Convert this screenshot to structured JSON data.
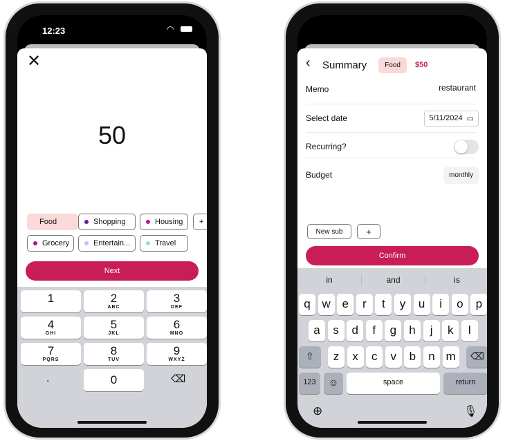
{
  "left": {
    "status": {
      "time": "12:23"
    },
    "amount": "50",
    "categories": [
      {
        "label": "Food",
        "color": "#f8d3d3",
        "selected": true
      },
      {
        "label": "Shopping",
        "color": "#6a1aa8"
      },
      {
        "label": "Housing",
        "color": "#c21896"
      },
      {
        "label": "+"
      },
      {
        "label": "Grocery",
        "color": "#a0199a"
      },
      {
        "label": "Entertain...",
        "color": "#d8b4f8"
      },
      {
        "label": "Travel",
        "color": "#8ee8c8"
      }
    ],
    "next_label": "Next",
    "keys": [
      {
        "d": "1",
        "l": ""
      },
      {
        "d": "2",
        "l": "ABC"
      },
      {
        "d": "3",
        "l": "DEF"
      },
      {
        "d": "4",
        "l": "GHI"
      },
      {
        "d": "5",
        "l": "JKL"
      },
      {
        "d": "6",
        "l": "MNO"
      },
      {
        "d": "7",
        "l": "PQRS"
      },
      {
        "d": "8",
        "l": "TUV"
      },
      {
        "d": "9",
        "l": "WXYZ"
      }
    ],
    "dot_key": ".",
    "zero_key": "0"
  },
  "right": {
    "title": "Summary",
    "category": "Food",
    "amount": "$50",
    "memo_label": "Memo",
    "memo_value": "restaurant",
    "date_label": "Select date",
    "date_value": "5/11/2024",
    "recurring_label": "Recurring?",
    "recurring_on": false,
    "budget_label": "Budget",
    "budget_value": "monthly",
    "new_sub_label": "New sub",
    "add_label": "+",
    "confirm_label": "Confirm",
    "suggestions": [
      "in",
      "and",
      "is"
    ],
    "rows": [
      [
        "q",
        "w",
        "e",
        "r",
        "t",
        "y",
        "u",
        "i",
        "o",
        "p"
      ],
      [
        "a",
        "s",
        "d",
        "f",
        "g",
        "h",
        "j",
        "k",
        "l"
      ],
      [
        "z",
        "x",
        "c",
        "v",
        "b",
        "n",
        "m"
      ]
    ],
    "num_key": "123",
    "space_key": "space",
    "return_key": "return"
  },
  "colors": {
    "accent": "#c81d56",
    "chip_selected": "#fcd9d9"
  }
}
